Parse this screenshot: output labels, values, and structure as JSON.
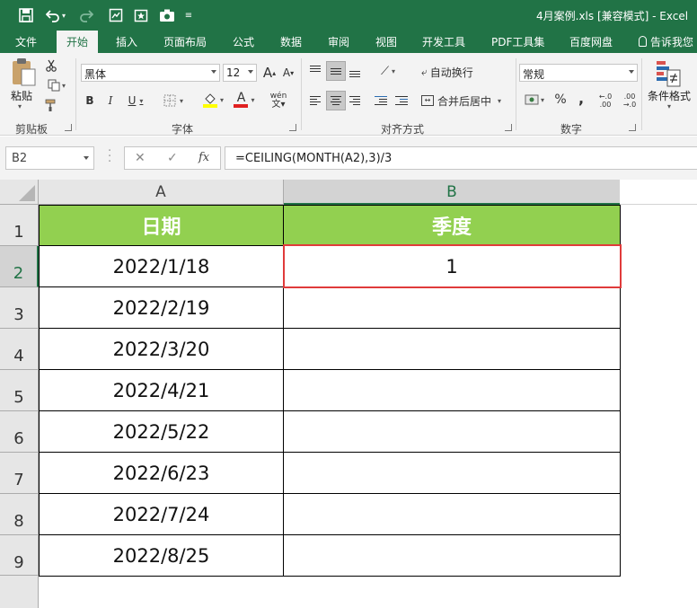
{
  "window": {
    "title": "4月案例.xls  [兼容模式] - Excel"
  },
  "tabs": [
    "文件",
    "开始",
    "插入",
    "页面布局",
    "公式",
    "数据",
    "审阅",
    "视图",
    "开发工具",
    "PDF工具集",
    "百度网盘",
    "告诉我您"
  ],
  "ribbon": {
    "clipboard": {
      "paste_label": "粘贴",
      "group_label": "剪贴板"
    },
    "font": {
      "font_name": "黑体",
      "font_size": "12",
      "group_label": "字体",
      "phonetic_label": "wén"
    },
    "alignment": {
      "wrap_label": "自动换行",
      "merge_label": "合并后居中",
      "group_label": "对齐方式"
    },
    "number": {
      "format": "常规",
      "group_label": "数字",
      "percent": "%",
      "comma": ","
    },
    "styles": {
      "cond_format_label": "条件格式"
    }
  },
  "formula_bar": {
    "name_box": "B2",
    "cancel": "✕",
    "enter": "✓",
    "fx": "fx",
    "formula": "=CEILING(MONTH(A2),3)/3"
  },
  "sheet": {
    "columns": [
      "A",
      "B"
    ],
    "rows": [
      "1",
      "2",
      "3",
      "4",
      "5",
      "6",
      "7",
      "8",
      "9"
    ],
    "header": [
      "日期",
      "季度"
    ],
    "data": [
      [
        "2022/1/18",
        "1"
      ],
      [
        "2022/2/19",
        ""
      ],
      [
        "2022/3/20",
        ""
      ],
      [
        "2022/4/21",
        ""
      ],
      [
        "2022/5/22",
        ""
      ],
      [
        "2022/6/23",
        ""
      ],
      [
        "2022/7/24",
        ""
      ],
      [
        "2022/8/25",
        ""
      ]
    ],
    "selected_cell": "B2",
    "header_fill": "#92d050",
    "selection_color": "#e03b3b"
  },
  "colors": {
    "excel_green": "#217346"
  }
}
